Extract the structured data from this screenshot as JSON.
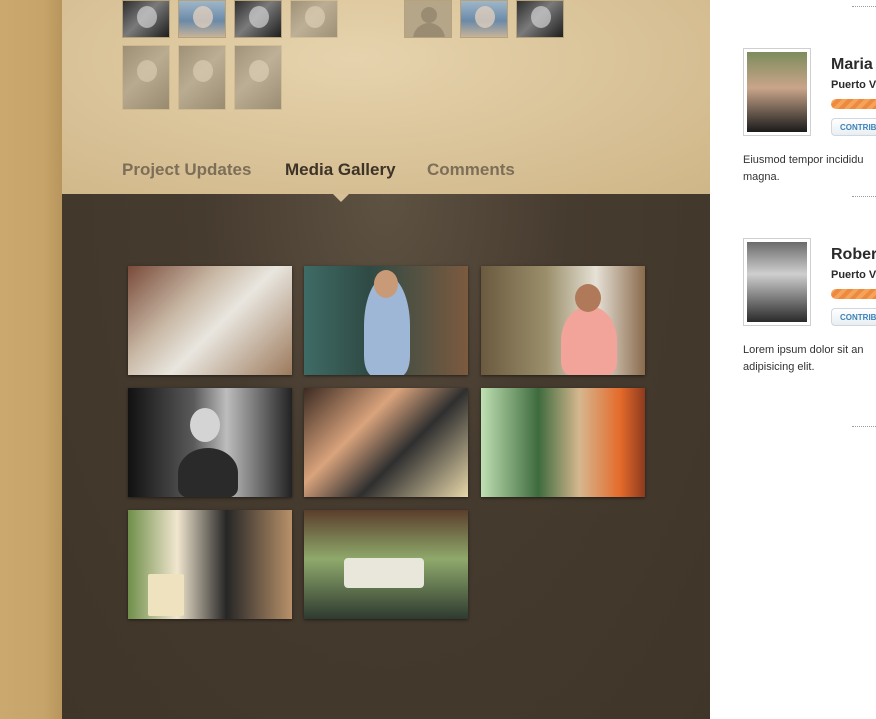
{
  "tabs": {
    "project_updates": "Project Updates",
    "media_gallery": "Media Gallery",
    "comments": "Comments"
  },
  "sidebar": {
    "members": [
      {
        "name": "Maria",
        "location": "Puerto V",
        "contribute_label": "CONTRIB",
        "text_line1": "Eiusmod tempor incididu",
        "text_line2": "magna."
      },
      {
        "name": "Rober",
        "location": "Puerto V",
        "contribute_label": "CONTRIB",
        "text_line1": "Lorem ipsum dolor sit an",
        "text_line2": "adipisicing elit."
      }
    ]
  },
  "colors": {
    "page_bg": "#c9a870",
    "top_panel": "#d8c196",
    "gallery_bg": "#463b2f",
    "sidebar_bg": "#ffffff",
    "progress": "#ee8a3e",
    "contribute_text": "#3b83b8"
  },
  "icons": {
    "placeholder_avatar": "person-silhouette-icon"
  }
}
